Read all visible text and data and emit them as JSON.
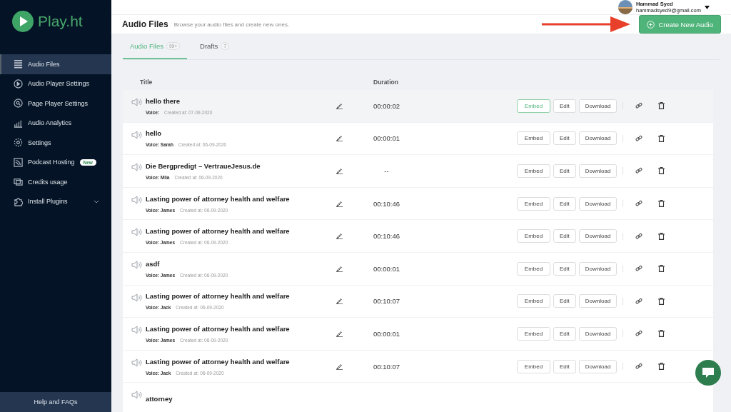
{
  "sidebar": {
    "logo": "Play.ht",
    "items": [
      {
        "label": "Audio Files",
        "selected": true
      },
      {
        "label": "Audio Player Settings",
        "selected": false
      },
      {
        "label": "Page Player Settings",
        "selected": false
      },
      {
        "label": "Audio Analytics",
        "selected": false
      },
      {
        "label": "Settings",
        "selected": false
      },
      {
        "label": "Podcast Hosting",
        "selected": false,
        "badge": "New"
      },
      {
        "label": "Credits usage",
        "selected": false
      },
      {
        "label": "Install Plugins",
        "selected": false,
        "expandable": true
      }
    ],
    "footer": "Help and FAQs"
  },
  "user": {
    "name": "Hammad Syed",
    "email": "hammadsyed9@gmail.com"
  },
  "page": {
    "title": "Audio Files",
    "subtitle": "Browse your audio files and create new ones.",
    "create_button": "Create New Audio"
  },
  "tabs": [
    {
      "label": "Audio Files",
      "count": "99+",
      "selected": true
    },
    {
      "label": "Drafts",
      "count": "7",
      "selected": false
    }
  ],
  "table": {
    "columns": [
      "Title",
      "Duration"
    ],
    "rows": [
      {
        "title": "hello there",
        "voice": "Voice:",
        "created": "Created at: 07-09-2020",
        "duration": "00:00:02",
        "actions": [
          "Embed",
          "Edit",
          "Download"
        ],
        "selected": true
      },
      {
        "title": "hello",
        "voice": "Voice: Sarah",
        "created": "Created at: 06-09-2020",
        "duration": "00:00:01",
        "actions": [
          "Embed",
          "Edit",
          "Download"
        ],
        "selected": false
      },
      {
        "title": "Die Bergpredigt – VertraueJesus.de",
        "voice": "Voice: Mila",
        "created": "Created at: 06-09-2020",
        "duration": "--",
        "actions": [
          "Embed",
          "Edit",
          "Download"
        ],
        "selected": false
      },
      {
        "title": "Lasting power of attorney health and welfare",
        "voice": "Voice: James",
        "created": "Created at: 06-09-2020",
        "duration": "00:10:46",
        "actions": [
          "Embed",
          "Edit",
          "Download"
        ],
        "selected": false
      },
      {
        "title": "Lasting power of attorney health and welfare",
        "voice": "Voice: James",
        "created": "Created at: 06-09-2020",
        "duration": "00:10:46",
        "actions": [
          "Embed",
          "Edit",
          "Download"
        ],
        "selected": false
      },
      {
        "title": "asdf",
        "voice": "Voice: James",
        "created": "Created at: 06-09-2020",
        "duration": "00:00:01",
        "actions": [
          "Embed",
          "Edit",
          "Download"
        ],
        "selected": false
      },
      {
        "title": "Lasting power of attorney health and welfare",
        "voice": "Voice: Jack",
        "created": "Created at: 06-09-2020",
        "duration": "00:10:07",
        "actions": [
          "Embed",
          "Edit",
          "Download"
        ],
        "selected": false
      },
      {
        "title": "Lasting power of attorney health and welfare",
        "voice": "Voice: James",
        "created": "Created at: 06-09-2020",
        "duration": "00:00:01",
        "actions": [
          "Embed",
          "Edit",
          "Download"
        ],
        "selected": false
      },
      {
        "title": "Lasting power of attorney health and welfare",
        "voice": "Voice: Jack",
        "created": "Created at: 06-09-2020",
        "duration": "00:10:07",
        "actions": [
          "Embed",
          "Edit",
          "Download"
        ],
        "selected": false
      },
      {
        "title": "attorney",
        "selected": false
      }
    ]
  }
}
